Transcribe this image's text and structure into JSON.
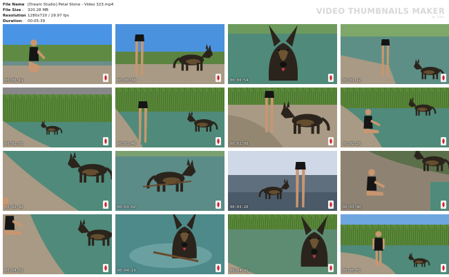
{
  "file_info": {
    "rows": [
      {
        "key": "File Name",
        "value": "[Dream Studio] Petal Stone - Video 323.mp4"
      },
      {
        "key": "File Size",
        "value": "320.28 MB"
      },
      {
        "key": "Resolution",
        "value": "1280x720 / 29.97 fps"
      },
      {
        "key": "Duration",
        "value": "00:05:39"
      }
    ]
  },
  "brand": {
    "title": "VIDEO THUMBNAILS MAKER",
    "subtitle": "by Tools"
  },
  "thumbnails": [
    {
      "timestamp": "00:00:19",
      "scene": "sky-girl-squat"
    },
    {
      "timestamp": "00:00:38",
      "scene": "sky-legs-dog"
    },
    {
      "timestamp": "00:00:54",
      "scene": "water-dog-close"
    },
    {
      "timestamp": "00:01:12",
      "scene": "water-girl-dog"
    },
    {
      "timestamp": "00:01:31",
      "scene": "reeds-shore-dog"
    },
    {
      "timestamp": "00:01:48",
      "scene": "reeds-legs-dog"
    },
    {
      "timestamp": "00:02:08",
      "scene": "reeds-dog-walk"
    },
    {
      "timestamp": "00:02:26",
      "scene": "reeds-girl-sit-dog"
    },
    {
      "timestamp": "00:02:42",
      "scene": "shore-dog-head"
    },
    {
      "timestamp": "00:03:02",
      "scene": "water-dog-stick"
    },
    {
      "timestamp": "00:03:20",
      "scene": "sunset-girl-dog"
    },
    {
      "timestamp": "00:03:40",
      "scene": "shore-girl-dog-run"
    },
    {
      "timestamp": "00:04:02",
      "scene": "shore-hand-dog"
    },
    {
      "timestamp": "00:04:19",
      "scene": "water-dog-swim"
    },
    {
      "timestamp": "00:04:41",
      "scene": "reeds-dog-head"
    },
    {
      "timestamp": "00:05:01",
      "scene": "reeds-girl-stand-dog"
    }
  ],
  "colors": {
    "sky": "#3f8fe0",
    "water": "#4f8a7a",
    "reeds": "#5b8a3a",
    "sand": "#a89a84",
    "dog": "#2b241c",
    "dog_tan": "#8a6a3c",
    "skin": "#c99670"
  }
}
